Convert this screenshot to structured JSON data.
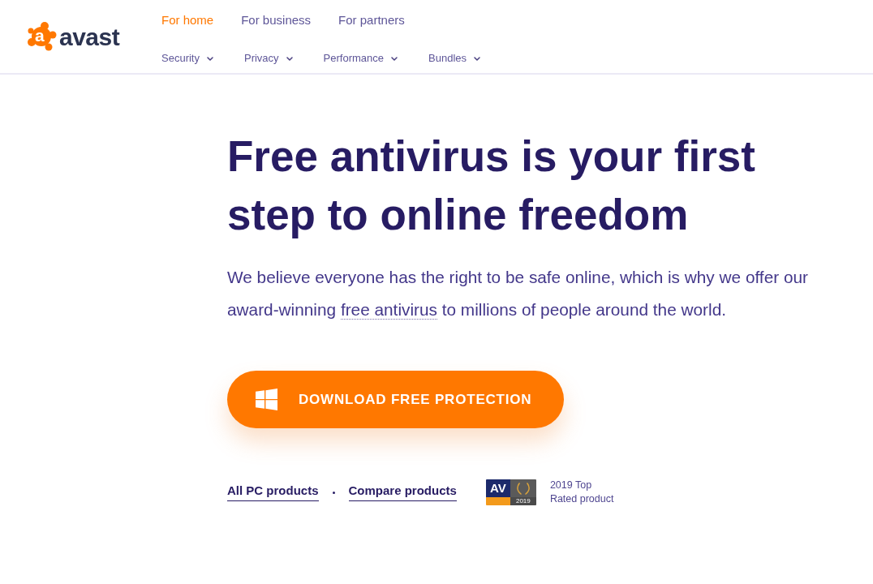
{
  "header": {
    "logo": {
      "mark_letter": "a",
      "wordmark": "avast"
    },
    "audience_tabs": [
      {
        "label": "For home",
        "selected": true
      },
      {
        "label": "For business",
        "selected": false
      },
      {
        "label": "For partners",
        "selected": false
      }
    ],
    "category_menu": [
      {
        "label": "Security"
      },
      {
        "label": "Privacy"
      },
      {
        "label": "Performance"
      },
      {
        "label": "Bundles"
      }
    ]
  },
  "hero": {
    "title": "Free antivirus is your first step to online freedom",
    "description": {
      "text_before": "We believe everyone has the right to be safe online, which is why we offer our award-winning ",
      "link": "free antivirus",
      "text_after": " to millions of people around the world."
    },
    "download_button": {
      "label": "DOWNLOAD FREE PROTECTION"
    },
    "product_links": [
      "All PC products",
      "Compare products"
    ],
    "award": {
      "badge": {
        "logo": "AV",
        "year": "2019"
      },
      "caption": "2019 Top Rated product"
    }
  }
}
